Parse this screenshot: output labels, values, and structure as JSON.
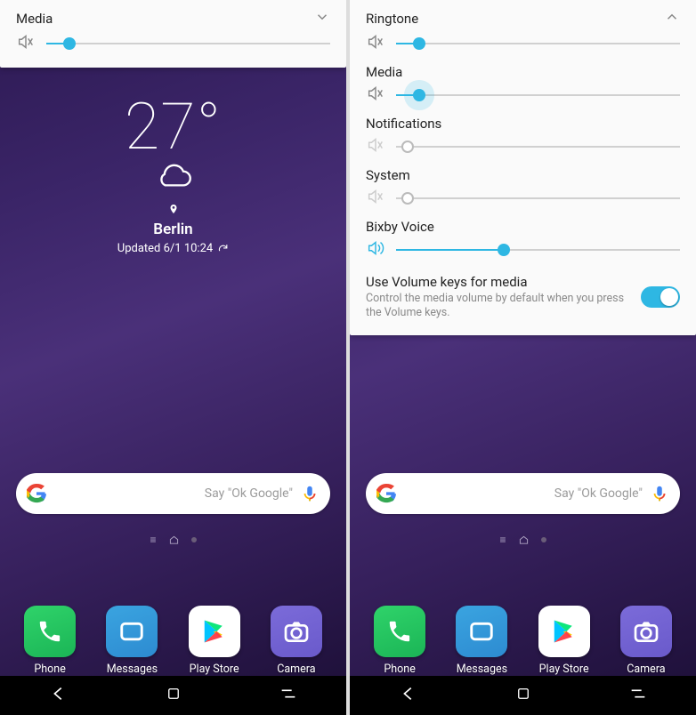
{
  "left": {
    "volume": {
      "label": "Media",
      "value": 8
    },
    "weather": {
      "temp": "27°",
      "city": "Berlin",
      "updated": "Updated 6/1 10:24"
    },
    "search_hint": "Say \"Ok Google\""
  },
  "right": {
    "sliders": {
      "ringtone": {
        "label": "Ringtone",
        "value": 8,
        "muted": false
      },
      "media": {
        "label": "Media",
        "value": 8,
        "muted": false
      },
      "notifications": {
        "label": "Notifications",
        "value": 0,
        "muted": true
      },
      "system": {
        "label": "System",
        "value": 0,
        "muted": true
      },
      "bixby": {
        "label": "Bixby Voice",
        "value": 38,
        "muted": false
      }
    },
    "toggle": {
      "title": "Use Volume keys for media",
      "sub": "Control the media volume by default when you press the Volume keys."
    },
    "search_hint": "Say \"Ok Google\""
  },
  "apps": [
    {
      "name": "Phone"
    },
    {
      "name": "Messages"
    },
    {
      "name": "Play Store"
    },
    {
      "name": "Camera"
    }
  ]
}
